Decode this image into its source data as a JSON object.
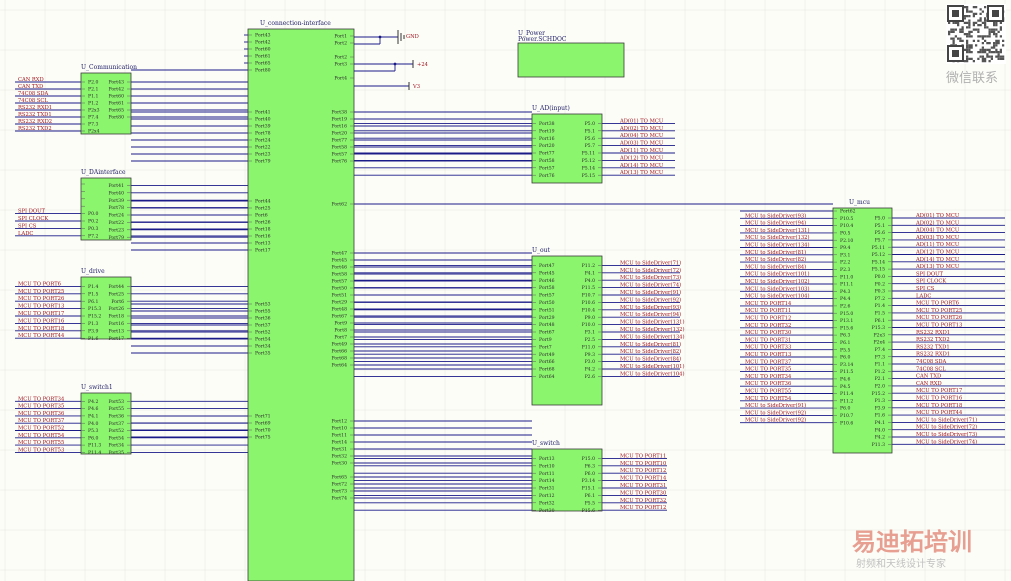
{
  "power_symbols": {
    "gnd": "GND",
    "p24": "+24",
    "p3v3": "V3"
  },
  "power_block": {
    "title": "U_Power",
    "subtitle": "Power.SCHDOC"
  },
  "watermark": {
    "brand": "易迪拓培训",
    "tagline": "射频和天线设计专家",
    "qr_caption": "微信联系"
  },
  "components": [
    {
      "id": "conn",
      "title": "U_connection-interface",
      "left": [
        {
          "pin": "Port43",
          "gap": 6
        },
        {
          "pin": "Port42"
        },
        {
          "pin": "Port60"
        },
        {
          "pin": "Port61"
        },
        {
          "pin": "Port65"
        },
        {
          "pin": "Port80"
        },
        {
          "pin": "Port41",
          "gap": 42
        },
        {
          "pin": "Port40"
        },
        {
          "pin": "Port39"
        },
        {
          "pin": "Port78"
        },
        {
          "pin": "Port24"
        },
        {
          "pin": "Port22"
        },
        {
          "pin": "Port23"
        },
        {
          "pin": "Port79"
        },
        {
          "pin": "Port44",
          "gap": 40
        },
        {
          "pin": "Port25"
        },
        {
          "pin": "Port6"
        },
        {
          "pin": "Port26"
        },
        {
          "pin": "Port18"
        },
        {
          "pin": "Port16"
        },
        {
          "pin": "Port13"
        },
        {
          "pin": "Port17"
        },
        {
          "pin": "Port53",
          "gap": 54
        },
        {
          "pin": "Port55"
        },
        {
          "pin": "Port36"
        },
        {
          "pin": "Port37"
        },
        {
          "pin": "Port52"
        },
        {
          "pin": "Port54"
        },
        {
          "pin": "Port34"
        },
        {
          "pin": "Port35"
        },
        {
          "pin": "Port71",
          "gap": 63
        },
        {
          "pin": "Port69"
        },
        {
          "pin": "Port70"
        },
        {
          "pin": "Port75"
        }
      ],
      "right": [
        {
          "pin": "Port1",
          "gap": 7
        },
        {
          "pin": "Port2"
        },
        {
          "pin": "Port2",
          "gap": 14
        },
        {
          "pin": "Port3"
        },
        {
          "pin": "Port4",
          "gap": 14
        },
        {
          "pin": "Port38",
          "gap": 34
        },
        {
          "pin": "Port19"
        },
        {
          "pin": "Port16"
        },
        {
          "pin": "Port20"
        },
        {
          "pin": "Port77"
        },
        {
          "pin": "Port58"
        },
        {
          "pin": "Port57"
        },
        {
          "pin": "Port76"
        },
        {
          "pin": "Port62",
          "gap": 43
        },
        {
          "pin": "Port47",
          "gap": 49
        },
        {
          "pin": "Port45"
        },
        {
          "pin": "Port46"
        },
        {
          "pin": "Port58"
        },
        {
          "pin": "Port57"
        },
        {
          "pin": "Port50"
        },
        {
          "pin": "Port51"
        },
        {
          "pin": "Port29"
        },
        {
          "pin": "Port48"
        },
        {
          "pin": "Port67"
        },
        {
          "pin": "Port9"
        },
        {
          "pin": "Port8"
        },
        {
          "pin": "Port7"
        },
        {
          "pin": "Port49"
        },
        {
          "pin": "Port66"
        },
        {
          "pin": "Port68"
        },
        {
          "pin": "Port64"
        },
        {
          "pin": "Port12",
          "gap": 56
        },
        {
          "pin": "Port10"
        },
        {
          "pin": "Port11"
        },
        {
          "pin": "Port14"
        },
        {
          "pin": "Port31"
        },
        {
          "pin": "Port32"
        },
        {
          "pin": "Port30"
        },
        {
          "pin": "Port65",
          "gap": 14
        },
        {
          "pin": "Port72"
        },
        {
          "pin": "Port73"
        },
        {
          "pin": "Port74"
        }
      ]
    },
    {
      "id": "communication",
      "title": "U_Communication",
      "left": [
        {
          "pin": "P2.0",
          "net": "CAN RXD"
        },
        {
          "pin": "P2.1",
          "net": "CAN TXD"
        },
        {
          "pin": "P1.1",
          "net": "74C08 SDA"
        },
        {
          "pin": "P1.2",
          "net": "74C08 SCL"
        },
        {
          "pin": "P2x3",
          "net": "RS232 RXD1"
        },
        {
          "pin": "P7.4",
          "net": "RS232 TXD1"
        },
        {
          "pin": "P7.3",
          "net": "RS232 RXD2"
        },
        {
          "pin": "P2x4",
          "net": "RS232 TXD2"
        }
      ],
      "right": [
        {
          "pin": "Port43"
        },
        {
          "pin": "Port42"
        },
        {
          "pin": "Port60"
        },
        {
          "pin": "Port61"
        },
        {
          "pin": "Port65"
        },
        {
          "pin": "Port80"
        }
      ]
    },
    {
      "id": "dainterface",
      "title": "U_DAinterface",
      "left": [
        {
          "pin": "",
          "gap": 6
        },
        {
          "pin": ""
        },
        {
          "pin": ""
        },
        {
          "pin": ""
        },
        {
          "pin": "P0.0",
          "net": "SPI DOUT"
        },
        {
          "pin": "P0.2",
          "net": "SPI CLOCK"
        },
        {
          "pin": "P0.3",
          "net": "SPI CS"
        },
        {
          "pin": "P7.2",
          "net": "LADC"
        }
      ],
      "right": [
        {
          "pin": "Port41"
        },
        {
          "pin": "Port40"
        },
        {
          "pin": "Port39"
        },
        {
          "pin": "Port78"
        },
        {
          "pin": "Port24"
        },
        {
          "pin": "Port22"
        },
        {
          "pin": "Port23"
        },
        {
          "pin": "Port79"
        }
      ]
    },
    {
      "id": "drive",
      "title": "U_drive",
      "left": [
        {
          "pin": "P1.4",
          "net": "MCU TO PORT6"
        },
        {
          "pin": "P1.5",
          "net": "MCU TO PORT25"
        },
        {
          "pin": "P6.1",
          "net": "MCU TO PORT26"
        },
        {
          "pin": "P15.3",
          "net": "MCU TO PORT13"
        },
        {
          "pin": "P15.2",
          "net": "MCU TO PORT17"
        },
        {
          "pin": "P1.3",
          "net": "MCU TO PORT16"
        },
        {
          "pin": "P3.9",
          "net": "MCU TO PORT18"
        },
        {
          "pin": "P1.6",
          "net": "MCU TO PORT44"
        }
      ],
      "right": [
        {
          "pin": "Port44"
        },
        {
          "pin": "Port25"
        },
        {
          "pin": "Port6"
        },
        {
          "pin": "Port26"
        },
        {
          "pin": "Port18"
        },
        {
          "pin": "Port16"
        },
        {
          "pin": "Port13"
        },
        {
          "pin": "Port17"
        }
      ]
    },
    {
      "id": "switch1",
      "title": "U_switch1",
      "left": [
        {
          "pin": "P4.2",
          "net": "MCU TO PORT34"
        },
        {
          "pin": "P4.6",
          "net": "MCU TO PORT35"
        },
        {
          "pin": "P4.1",
          "net": "MCU TO PORT36"
        },
        {
          "pin": "P4.0",
          "net": "MCU TO PORT37"
        },
        {
          "pin": "P5.3",
          "net": "MCU TO PORT52"
        },
        {
          "pin": "P6.0",
          "net": "MCU TO PORT54"
        },
        {
          "pin": "P11.3",
          "net": "MCU TO PORT55"
        },
        {
          "pin": "P11.4",
          "net": "MCU TO PORT53"
        }
      ],
      "right": [
        {
          "pin": "Port53"
        },
        {
          "pin": "Port55"
        },
        {
          "pin": "Port36"
        },
        {
          "pin": "Port37"
        },
        {
          "pin": "Port52"
        },
        {
          "pin": "Port54"
        },
        {
          "pin": "Port34"
        },
        {
          "pin": "Port35"
        }
      ]
    },
    {
      "id": "ad",
      "title": "U_AD(input)",
      "left": [
        {
          "pin": "Port38"
        },
        {
          "pin": "Port19"
        },
        {
          "pin": "Port16"
        },
        {
          "pin": "Port20"
        },
        {
          "pin": "Port77"
        },
        {
          "pin": "Port58"
        },
        {
          "pin": "Port57"
        },
        {
          "pin": "Port76"
        }
      ],
      "right": [
        {
          "pin": "P5.0",
          "net": "AD(01) TO MCU"
        },
        {
          "pin": "P5.1",
          "net": "AD(02) TO MCU"
        },
        {
          "pin": "P5.6",
          "net": "AD(04) TO MCU"
        },
        {
          "pin": "P5.7",
          "net": "AD(03) TO MCU"
        },
        {
          "pin": "P5.11",
          "net": "AD(11) TO MCU"
        },
        {
          "pin": "P5.12",
          "net": "AD(12) TO MCU"
        },
        {
          "pin": "P5.14",
          "net": "AD(14) TO MCU"
        },
        {
          "pin": "P5.15",
          "net": "AD(13) TO MCU"
        }
      ]
    },
    {
      "id": "out",
      "title": "U_out",
      "left": [
        {
          "pin": "Port47"
        },
        {
          "pin": "Port45"
        },
        {
          "pin": "Port46"
        },
        {
          "pin": "Port58"
        },
        {
          "pin": "Port57"
        },
        {
          "pin": "Port50"
        },
        {
          "pin": "Port51"
        },
        {
          "pin": "Port29"
        },
        {
          "pin": "Port48"
        },
        {
          "pin": "Port67"
        },
        {
          "pin": "Port9"
        },
        {
          "pin": "Port7"
        },
        {
          "pin": "Port49"
        },
        {
          "pin": "Port66"
        },
        {
          "pin": "Port68"
        },
        {
          "pin": "Port64"
        }
      ],
      "right": [
        {
          "pin": "P11.2",
          "net": "MCU to SideDriver(71)"
        },
        {
          "pin": "P4.1",
          "net": "MCU to SideDriver(72)"
        },
        {
          "pin": "P4.0",
          "net": "MCU to SideDriver(73)"
        },
        {
          "pin": "P11.5",
          "net": "MCU to SideDriver(74)"
        },
        {
          "pin": "P10.7",
          "net": "MCU to SideDriver(91)"
        },
        {
          "pin": "P10.6",
          "net": "MCU to SideDriver(92)"
        },
        {
          "pin": "P10.4",
          "net": "MCU to SideDriver(93)"
        },
        {
          "pin": "P9.0",
          "net": "MCU to SideDriver(94)"
        },
        {
          "pin": "P10.0",
          "net": "MCU to SideDriver(131)"
        },
        {
          "pin": "P3.1",
          "net": "MCU to SideDriver(132)"
        },
        {
          "pin": "P2.5",
          "net": "MCU to SideDriver(134)"
        },
        {
          "pin": "P11.0",
          "net": "MCU to SideDriver(81)"
        },
        {
          "pin": "P9.3",
          "net": "MCU to SideDriver(82)"
        },
        {
          "pin": "P3.0",
          "net": "MCU to SideDriver(84)"
        },
        {
          "pin": "P4.2",
          "net": "MCU to SideDriver(101)"
        },
        {
          "pin": "P2.6",
          "net": "MCU to SideDriver(104)"
        }
      ]
    },
    {
      "id": "switch",
      "title": "U_switch",
      "left": [
        {
          "pin": "Port13"
        },
        {
          "pin": "Port10"
        },
        {
          "pin": "Port11"
        },
        {
          "pin": "Port14"
        },
        {
          "pin": "Port31"
        },
        {
          "pin": "Port12"
        },
        {
          "pin": "Port32"
        },
        {
          "pin": "Port30"
        }
      ],
      "right": [
        {
          "pin": "P15.0",
          "net": "MCU TO PORT11"
        },
        {
          "pin": "P6.3",
          "net": "MCU TO PORT10"
        },
        {
          "pin": "P6.0",
          "net": "MCU TO PORT12"
        },
        {
          "pin": "P3.14",
          "net": "MCU TO PORT14"
        },
        {
          "pin": "P15.1",
          "net": "MCU TO PORT31"
        },
        {
          "pin": "P6.1",
          "net": "MCU TO PORT30"
        },
        {
          "pin": "P5.5",
          "net": "MCU TO PORT32"
        },
        {
          "pin": "P15.6",
          "net": "MCU TO PORT12"
        }
      ]
    },
    {
      "id": "mcu",
      "title": "U_mcu",
      "left": [
        {
          "pin": "Port62",
          "gap": 3
        },
        {
          "pin": "P10.5",
          "net": "MCU to SideDriver(93)"
        },
        {
          "pin": "P10.4",
          "net": "MCU to SideDriver(94)"
        },
        {
          "pin": "P0.5",
          "net": "MCU to SideDriver(131)"
        },
        {
          "pin": "P2.10",
          "net": "MCU to SideDriver(132)"
        },
        {
          "pin": "P9.4",
          "net": "MCU to SideDriver(134)"
        },
        {
          "pin": "P3.1",
          "net": "MCU to SideDriver(81)"
        },
        {
          "pin": "P2.2",
          "net": "MCU to SideDriver(82)"
        },
        {
          "pin": "P2.3",
          "net": "MCU to SideDriver(84)"
        },
        {
          "pin": "P11.0",
          "net": "MCU to SideDriver(101)"
        },
        {
          "pin": "P11.1",
          "net": "MCU to SideDriver(102)"
        },
        {
          "pin": "P4.3",
          "net": "MCU to SideDriver(103)"
        },
        {
          "pin": "P4.4",
          "net": "MCU to SideDriver(104)"
        },
        {
          "pin": "P2.6",
          "net": "MCU TO PORT14"
        },
        {
          "pin": "P15.0",
          "net": "MCU TO PORT11"
        },
        {
          "pin": "P13.1",
          "net": "MCU TO PORT12"
        },
        {
          "pin": "P15.6",
          "net": "MCU TO PORT32"
        },
        {
          "pin": "P6.3",
          "net": "MCU TO PORT30"
        },
        {
          "pin": "P6.1",
          "net": "MCU TO PORT31"
        },
        {
          "pin": "P5.5",
          "net": "MCU TO PORT33"
        },
        {
          "pin": "P6.0",
          "net": "MCU TO PORT13"
        },
        {
          "pin": "P3.14",
          "net": "MCU TO PORT37"
        },
        {
          "pin": "P11.5",
          "net": "MCU TO PORT35"
        },
        {
          "pin": "P4.6",
          "net": "MCU TO PORT34"
        },
        {
          "pin": "P4.5",
          "net": "MCU TO PORT36"
        },
        {
          "pin": "P11.4",
          "net": "MCU TO PORT55"
        },
        {
          "pin": "P11.2",
          "net": "MCU TO PORT54"
        },
        {
          "pin": "P6.0",
          "net": "MCU to SideDriver(91)"
        },
        {
          "pin": "P10.7",
          "net": "MCU to SideDriver(92)"
        },
        {
          "pin": "P10.6",
          "net": "MCU to SideDriver(92)"
        }
      ],
      "right": [
        {
          "pin": "P5.0",
          "net": "AD(01) TO MCU",
          "gap": 10
        },
        {
          "pin": "P5.1",
          "net": "AD(02) TO MCU"
        },
        {
          "pin": "P5.6",
          "net": "AD(04) TO MCU"
        },
        {
          "pin": "P5.7",
          "net": "AD(03) TO MCU"
        },
        {
          "pin": "P5.11",
          "net": "AD(11) TO MCU"
        },
        {
          "pin": "P5.12",
          "net": "AD(12) TO MCU"
        },
        {
          "pin": "P5.14",
          "net": "AD(14) TO MCU"
        },
        {
          "pin": "P5.15",
          "net": "AD(13) TO MCU"
        },
        {
          "pin": "P0.0",
          "net": "SPI DOUT"
        },
        {
          "pin": "P0.2",
          "net": "SPI CLOCK"
        },
        {
          "pin": "P0.3",
          "net": "SPI CS"
        },
        {
          "pin": "P7.2",
          "net": "LADC"
        },
        {
          "pin": "P1.4",
          "net": "MCU TO PORT6"
        },
        {
          "pin": "P1.5",
          "net": "MCU TO PORT25"
        },
        {
          "pin": "P6.1",
          "net": "MCU TO PORT26"
        },
        {
          "pin": "P15.3",
          "net": "MCU TO PORT13"
        },
        {
          "pin": "P2x3",
          "net": "RS232 RXD1"
        },
        {
          "pin": "P2x4",
          "net": "RS232 TXD2"
        },
        {
          "pin": "P7.4",
          "net": "RS232 TXD1"
        },
        {
          "pin": "P7.3",
          "net": "RS232 RXD1"
        },
        {
          "pin": "P1.1",
          "net": "74C08 SDA"
        },
        {
          "pin": "P1.2",
          "net": "74C08 SCL"
        },
        {
          "pin": "P2.1",
          "net": "CAN TXD"
        },
        {
          "pin": "P2.0",
          "net": "CAN RXD"
        },
        {
          "pin": "P15.2",
          "net": "MCU TO PORT17"
        },
        {
          "pin": "P1.3",
          "net": "MCU TO PORT16"
        },
        {
          "pin": "P3.9",
          "net": "MCU TO PORT18"
        },
        {
          "pin": "P1.6",
          "net": "MCU TO PORT44"
        },
        {
          "pin": "P4.1",
          "net": "MCU to SideDriver(71)"
        },
        {
          "pin": "P4.0",
          "net": "MCU to SideDriver(72)"
        },
        {
          "pin": "P4.2",
          "net": "MCU to SideDriver(73)"
        },
        {
          "pin": "P11.3",
          "net": "MCU to SideDriver(74)"
        }
      ]
    }
  ]
}
